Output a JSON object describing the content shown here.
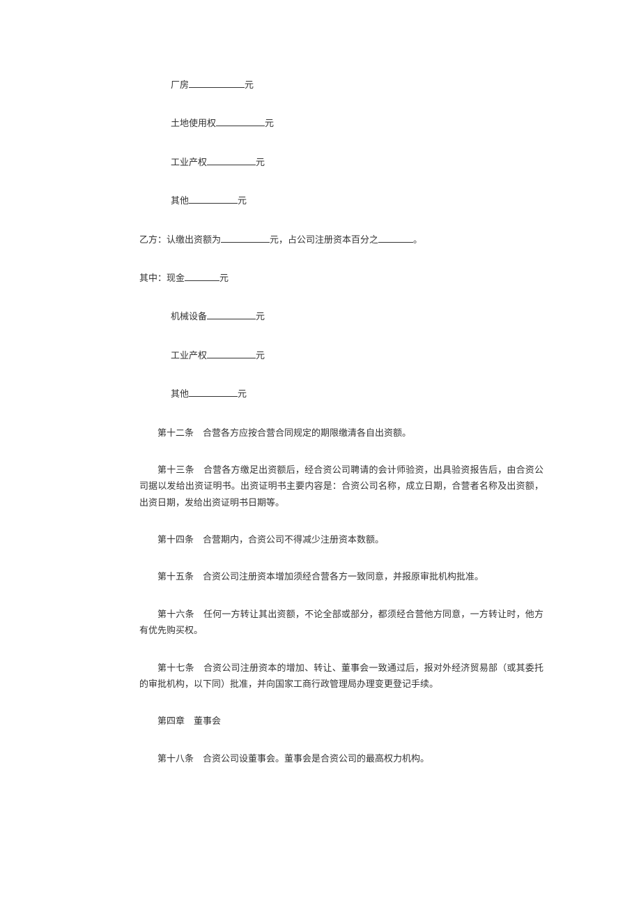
{
  "lines": {
    "l1_label": "厂房",
    "l1_unit": "元",
    "l2_label": "土地使用权",
    "l2_unit": "元",
    "l3_label": "工业产权",
    "l3_unit": "元",
    "l4_label": "其他",
    "l4_unit": "元",
    "l5_prefix": "乙方：认缴出资额为",
    "l5_mid": "元，占公司注册资本百分之",
    "l5_suffix": "。",
    "l6_prefix": "其中：现金",
    "l6_unit": "元",
    "l7_label": "机械设备",
    "l7_unit": "元",
    "l8_label": "工业产权",
    "l8_unit": "元",
    "l9_label": "其他",
    "l9_unit": "元"
  },
  "articles": {
    "a12": "第十二条　合营各方应按合营合同规定的期限缴清各自出资额。",
    "a13": "第十三条　合营各方缴足出资额后，经合资公司聘请的会计师验资，出具验资报告后，由合资公司据以发给出资证明书。出资证明书主要内容是：合资公司名称，成立日期，合营者名称及出资额，出资日期，发给出资证明书日期等。",
    "a14": "第十四条　合营期内，合资公司不得减少注册资本数额。",
    "a15": "第十五条　合资公司注册资本增加须经合营各方一致同意，并报原审批机构批准。",
    "a16": "第十六条　任何一方转让其出资额，不论全部或部分，都须经合营他方同意，一方转让时，他方有优先购买权。",
    "a17": "第十七条　合资公司注册资本的增加、转让、董事会一致通过后，报对外经济贸易部（或其委托的审批机构，以下同）批准，并向国家工商行政管理局办理变更登记手续。",
    "chapter4": "第四章　董事会",
    "a18": "第十八条　合资公司设董事会。董事会是合资公司的最高权力机构。"
  }
}
